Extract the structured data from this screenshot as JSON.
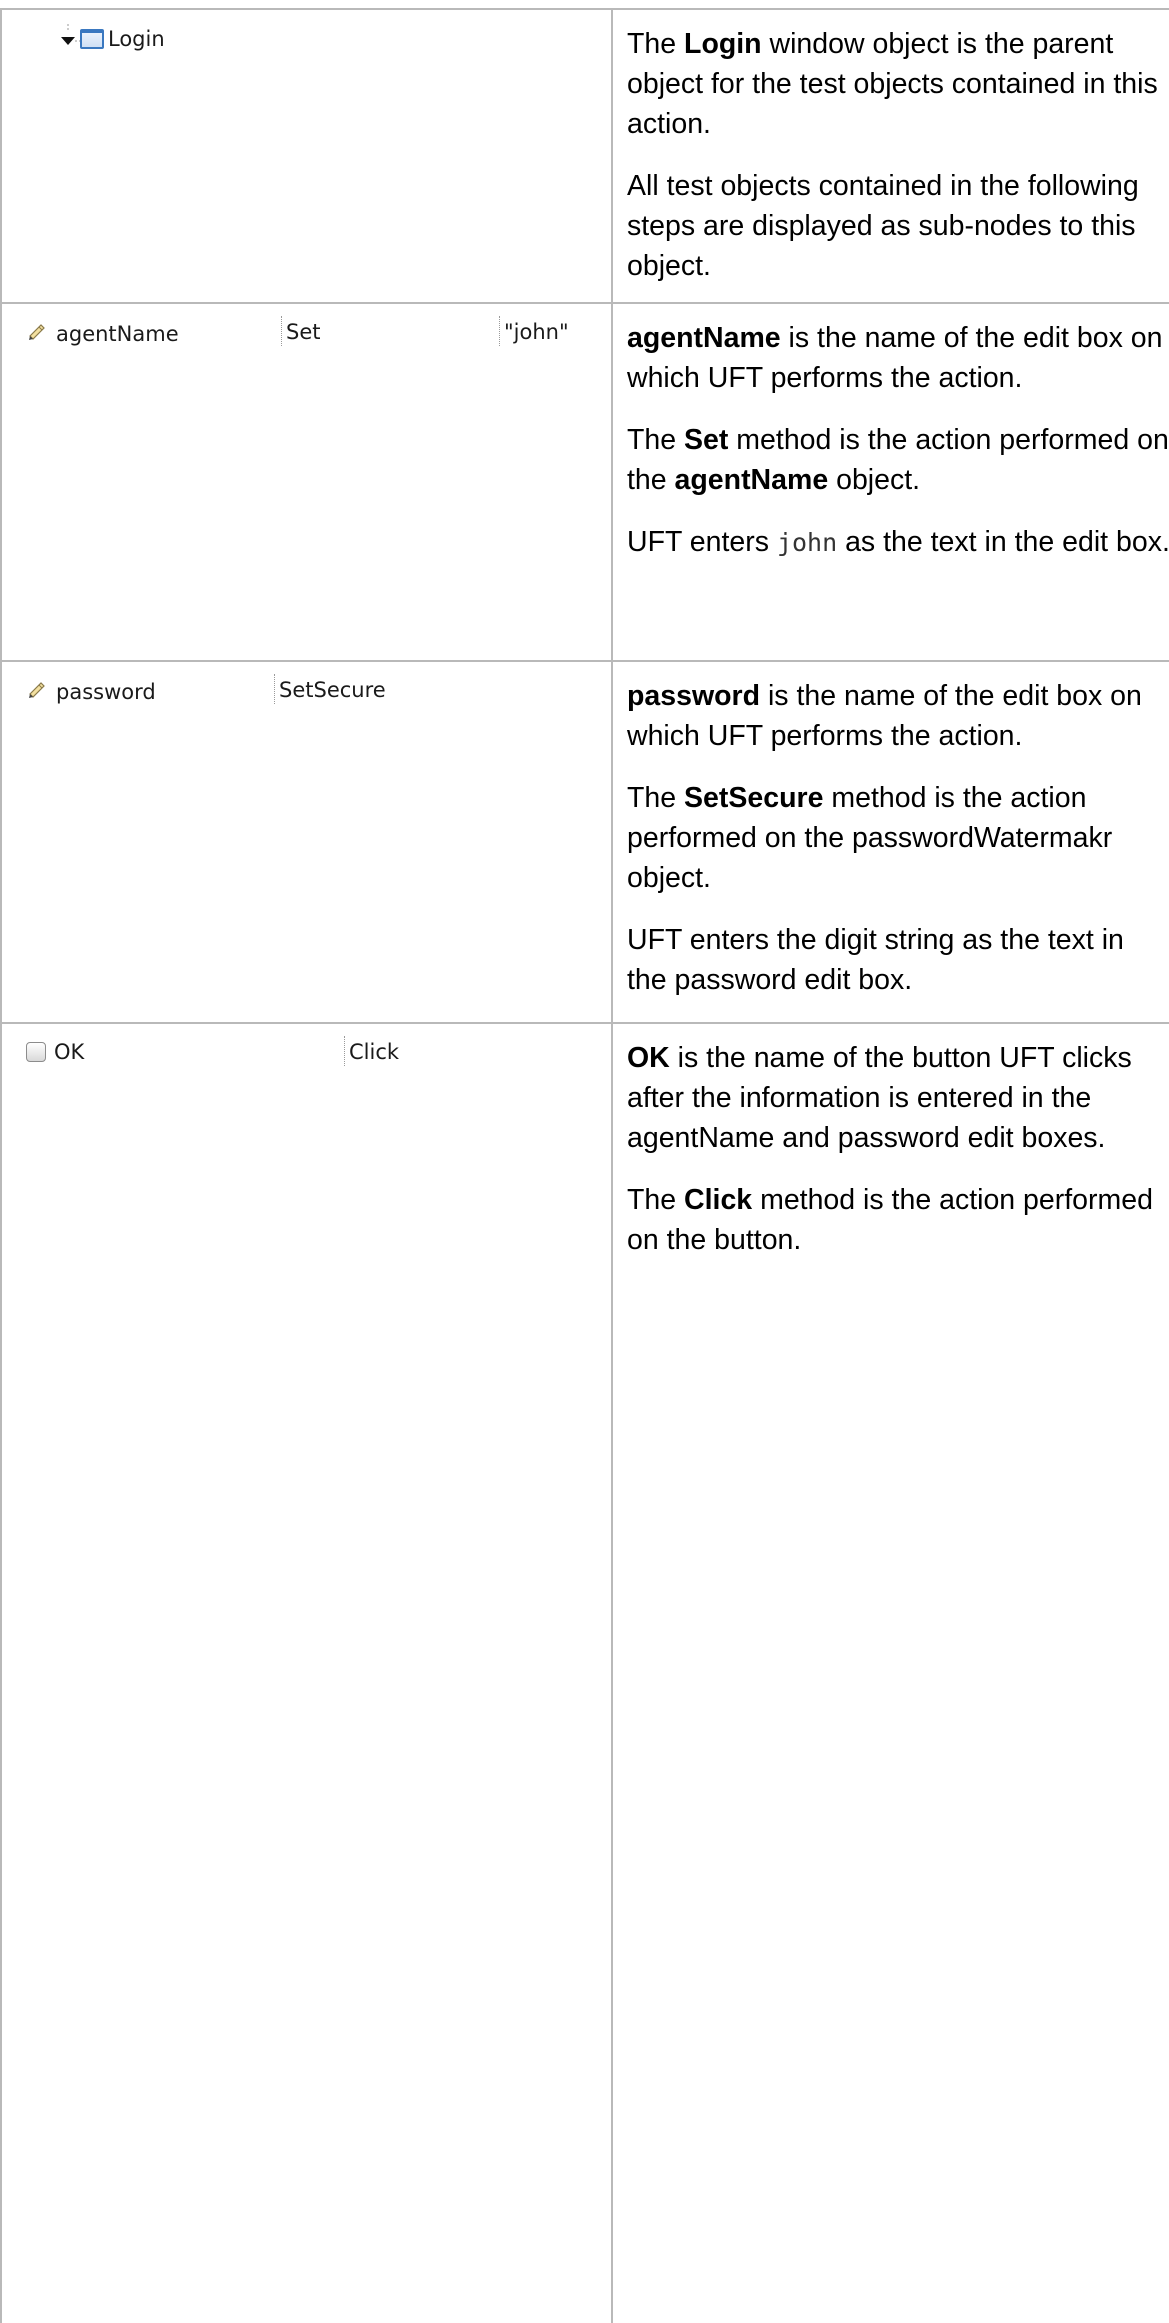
{
  "rows": [
    {
      "step": {
        "object": "Login",
        "operation": "",
        "value": ""
      },
      "paragraphs": [
        {
          "p0": "The ",
          "b0": "Login",
          "p1": " window object is the parent object for the test objects contained in this action."
        },
        {
          "p0": "All test objects contained in the following steps are displayed as sub-nodes to this object."
        }
      ]
    },
    {
      "step": {
        "object": "agentName",
        "operation": "Set",
        "value": "\"john\""
      },
      "paragraphs": [
        {
          "b0": "agentName",
          "p0": " is the name of the edit box on which UFT performs the action."
        },
        {
          "p0": "The ",
          "b0": "Set",
          "p1": " method is the action performed on the ",
          "b1": "agentName",
          "p2": "  object."
        },
        {
          "p0": "UFT enters ",
          "code": "john",
          "p1": " as the text in the edit box."
        }
      ]
    },
    {
      "step": {
        "object": "password",
        "operation": "SetSecure",
        "value": ""
      },
      "paragraphs": [
        {
          "b0": "password",
          "p0": " is the name of the edit box on which UFT performs the action."
        },
        {
          "p0": "The ",
          "b0": "SetSecure",
          "p1": " method is the action performed on the passwordWatermakr object."
        },
        {
          "p0": "UFT enters the digit string as the text in the password edit box."
        }
      ]
    },
    {
      "step": {
        "object": "OK",
        "operation": "Click",
        "value": ""
      },
      "paragraphs": [
        {
          "b0": "OK",
          "p0": " is the name of the button UFT clicks after the information is entered in the agentName and password edit boxes."
        },
        {
          "p0": "The ",
          "b0": "Click",
          "p1": " method is the action performed on the button."
        }
      ]
    }
  ],
  "icons": {
    "expand": "expand-arrow-icon",
    "window": "window-icon",
    "edit": "pencil-icon",
    "button": "button-icon",
    "window_color": "#3a78c0"
  }
}
